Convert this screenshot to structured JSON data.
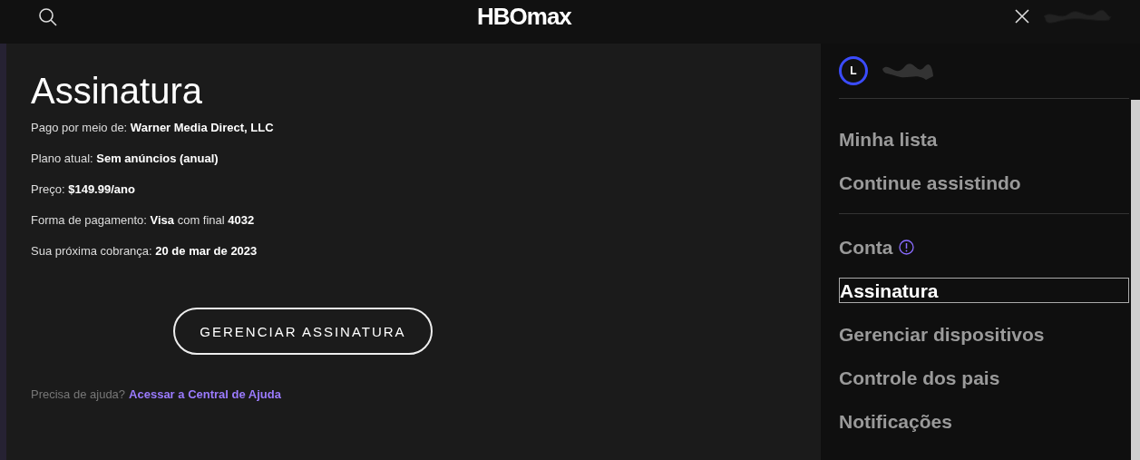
{
  "header": {
    "logo": "HBOmax"
  },
  "subscription": {
    "title": "Assinatura",
    "details": [
      "Pago por meio de: **Warner Media Direct, LLC**",
      "Plano atual: **Sem anúncios (anual)**",
      "Preço: **$149.99/ano**",
      "Forma de pagamento: **Visa** com final **4032**",
      "Sua próxima cobrança: **20 de mar de 2023**"
    ],
    "manage_button": "GERENCIAR ASSINATURA",
    "help": {
      "text": "Precisa de ajuda?",
      "link": "Acessar a Central de Ajuda"
    }
  },
  "profile": {
    "initial": "L"
  },
  "menu_groups": [
    [
      {
        "label": "Minha lista",
        "selected": false,
        "alert": false
      },
      {
        "label": "Continue assistindo",
        "selected": false,
        "alert": false
      }
    ],
    [
      {
        "label": "Conta",
        "selected": false,
        "alert": true
      },
      {
        "label": "Assinatura",
        "selected": true,
        "alert": false
      },
      {
        "label": "Gerenciar dispositivos",
        "selected": false,
        "alert": false
      },
      {
        "label": "Controle dos pais",
        "selected": false,
        "alert": false
      },
      {
        "label": "Notificações",
        "selected": false,
        "alert": false
      }
    ]
  ]
}
